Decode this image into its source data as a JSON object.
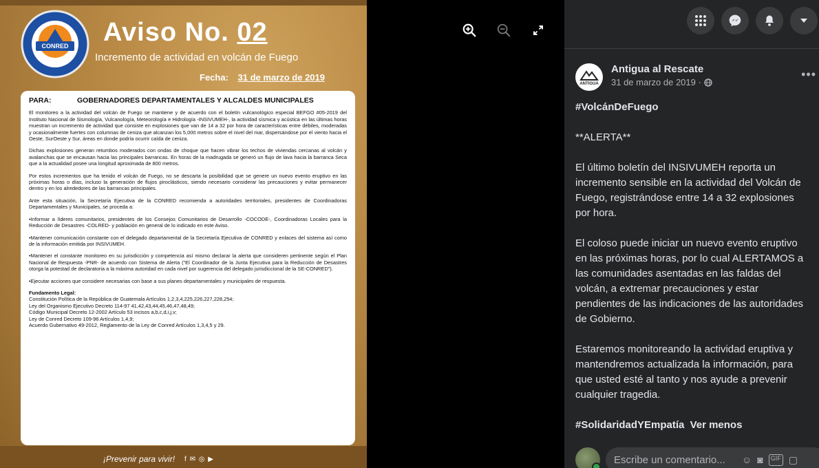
{
  "viewer": {
    "zoom_in_icon": "zoom-in-icon",
    "zoom_out_icon": "zoom-out-icon",
    "fullscreen_icon": "expand-icon"
  },
  "poster": {
    "seal_text": "CONRED",
    "title_prefix": "Aviso No.",
    "title_number": "02",
    "subtitle": "Incremento de actividad en volcán de Fuego",
    "date_label": "Fecha:",
    "date_value": "31 de marzo de 2019",
    "to_label": "PARA:",
    "to_value": "GOBERNADORES DEPARTAMENTALES Y ALCALDES MUNICIPALES",
    "paragraphs": [
      "El monitoreo a la actividad del volcán de Fuego se mantiene y de acuerdo con el boletín vulcanológico especial BEFGO #05-2019 del Instituto Nacional de Sismología, Vulcanología, Meteorología e Hidrología -INSIVUMEH-, la actividad sísmica y acústica en las últimas horas muestran un incremento de actividad que consiste en explosiones que van de 14 a 32 por hora de características entre débiles, moderadas y ocasionalmente fuertes con columnas de ceniza que alcanzan los 5,000 metros sobre el nivel del mar, dispersándose por el viento hacia el Oeste, SurOeste y Sur, áreas en donde podría ocurrir caída de ceniza.",
      "Dichas explosiones generan retumbos moderados con ondas de choque que hacen vibrar los techos de viviendas cercanas al volcán y avalanchas que se encausan hacia las principales barrancas. En horas de la madrugada se generó un flujo de lava hacia la barranca Seca que a la actualidad posee una longitud aproximada de 800 metros.",
      "Por estos incrementos que ha tenido el volcán de Fuego, no se descarta la posibilidad que se genere un nuevo evento eruptivo en las próximas horas o días, incluso la generación de flujos piroclásticos, siendo necesario considerar las precauciones y evitar permanecer dentro y en los alrededores de las barrancas principales.",
      "Ante esta situación, la Secretaría Ejecutiva de la CONRED recomienda a autoridades territoriales, presidentes de Coordinadoras Departamentales y Municipales, se proceda a:",
      "•Informar a líderes comunitarios, presidentes de los Consejos Comunitarios de Desarrollo -COCODE-, Coordinadoras Locales para la Reducción de Desastres -COLRED- y población en general de lo indicado en este Aviso.",
      "•Mantener comunicación constante con el delegado departamental de la Secretaría Ejecutiva de CONRED y enlaces del sistema así como de la información emitida por INSIVUMEH.",
      "•Mantener el constante monitoreo en su jurisdicción y competencia así mismo declarar la alerta que consideren pertinente según el Plan Nacional de Respuesta -PNR- de acuerdo con Sistema de Alerta (\"El Coordinador de la Junta Ejecutiva para la Reducción de Desastres otorga la potestad de declaratoria a la máxima autoridad en cada nivel por sugerencia del delegado jurisdiccional de la SE-CONRED\").",
      "•Ejecutar acciones que considere necesarias con base a sus planes departamentales y municipales de respuesta."
    ],
    "legal_title": "Fundamento Legal:",
    "legal_lines": [
      "Constitución Política de la República de Guatemala Artículos 1,2,3,4,225,226,227,228,254;",
      "Ley del Organismo Ejecutivo Decreto 114-97 41,42,43,44,45,46,47,48,49;",
      "Código Municipal Decreto 12-2002 Artículo 53 incisos a,b,c,d,i,j,v;",
      "Ley de Conred Decreto 109-96 Artículos 1,4,9;",
      "Acuerdo Gubernativo 49-2012, Reglamento de la Ley de Conred Artículos 1,3,4,5 y 29."
    ],
    "footer_slogan": "¡Prevenir para vivir!"
  },
  "topbar": {
    "menu_icon": "grid-menu-icon",
    "messenger_icon": "messenger-icon",
    "notifications_icon": "bell-icon",
    "account_icon": "caret-down-icon"
  },
  "post": {
    "author": "Antigua al Rescate",
    "avatar_text": "ANTIGUA",
    "time": "31 de marzo de 2019 ·",
    "privacy_icon": "globe-icon",
    "more_icon": "more-icon",
    "hashtag_1": "#VolcánDeFuego",
    "alert": "**ALERTA**",
    "lines_p1": [
      "El último boletín del INSIVUMEH reporta un",
      "incremento sensible en la actividad del Volcán de",
      "Fuego, registrándose entre 14 a 32 explosiones",
      "por hora."
    ],
    "lines_p2": [
      "El coloso puede iniciar un nuevo evento eruptivo",
      "en las próximas horas, por lo cual ALERTAMOS a",
      "las comunidades asentadas en las faldas del",
      "volcán, a extremar precauciones y estar",
      "pendientes de las indicaciones de las autoridades",
      "de Gobierno."
    ],
    "lines_p3": [
      "Estaremos monitoreando la actividad eruptiva y",
      "mantendremos actualizada la información, para",
      "que usted esté al tanto y nos ayude a prevenir",
      "cualquier tragedia."
    ],
    "hashtag_2": "#SolidaridadYEmpatía",
    "see_less": "Ver menos"
  },
  "comment": {
    "placeholder": "Escribe un comentario...",
    "emoji_icon": "emoji-icon",
    "camera_icon": "camera-icon",
    "gif_label": "GIF",
    "sticker_icon": "sticker-icon"
  }
}
